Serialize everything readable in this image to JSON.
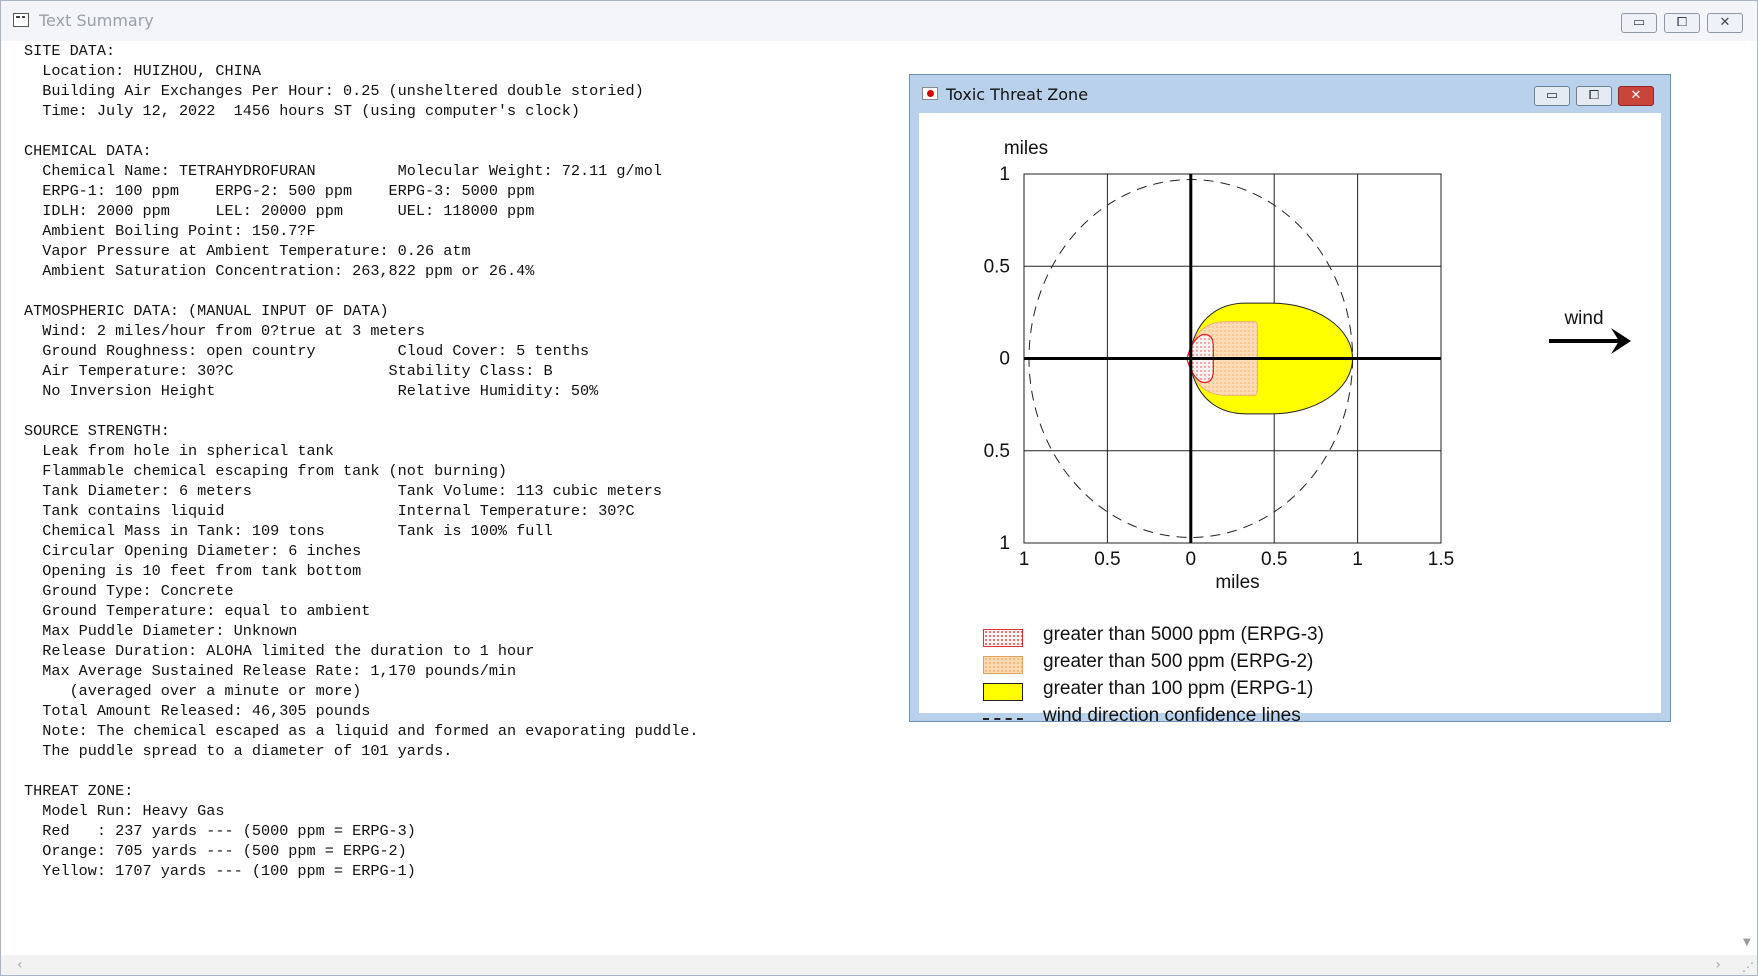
{
  "main_window": {
    "title": "Text Summary",
    "controls": {
      "minimize": "▭",
      "maximize": "⧠",
      "close": "✕"
    },
    "lines": [
      "SITE DATA:",
      "  Location: HUIZHOU, CHINA",
      "  Building Air Exchanges Per Hour: 0.25 (unsheltered double storied)",
      "  Time: July 12, 2022  1456 hours ST (using computer's clock)",
      "",
      "CHEMICAL DATA:",
      "  Chemical Name: TETRAHYDROFURAN         Molecular Weight: 72.11 g/mol",
      "  ERPG-1: 100 ppm    ERPG-2: 500 ppm    ERPG-3: 5000 ppm",
      "  IDLH: 2000 ppm     LEL: 20000 ppm      UEL: 118000 ppm",
      "  Ambient Boiling Point: 150.7?F",
      "  Vapor Pressure at Ambient Temperature: 0.26 atm",
      "  Ambient Saturation Concentration: 263,822 ppm or 26.4%",
      "",
      "ATMOSPHERIC DATA: (MANUAL INPUT OF DATA)",
      "  Wind: 2 miles/hour from 0?true at 3 meters",
      "  Ground Roughness: open country         Cloud Cover: 5 tenths",
      "  Air Temperature: 30?C                 Stability Class: B",
      "  No Inversion Height                    Relative Humidity: 50%",
      "",
      "SOURCE STRENGTH:",
      "  Leak from hole in spherical tank",
      "  Flammable chemical escaping from tank (not burning)",
      "  Tank Diameter: 6 meters                Tank Volume: 113 cubic meters",
      "  Tank contains liquid                   Internal Temperature: 30?C",
      "  Chemical Mass in Tank: 109 tons        Tank is 100% full",
      "  Circular Opening Diameter: 6 inches",
      "  Opening is 10 feet from tank bottom",
      "  Ground Type: Concrete",
      "  Ground Temperature: equal to ambient",
      "  Max Puddle Diameter: Unknown",
      "  Release Duration: ALOHA limited the duration to 1 hour",
      "  Max Average Sustained Release Rate: 1,170 pounds/min",
      "     (averaged over a minute or more)",
      "  Total Amount Released: 46,305 pounds",
      "  Note: The chemical escaped as a liquid and formed an evaporating puddle.",
      "  The puddle spread to a diameter of 101 yards.",
      "",
      "THREAT ZONE:",
      "  Model Run: Heavy Gas",
      "  Red   : 237 yards --- (5000 ppm = ERPG-3)",
      "  Orange: 705 yards --- (500 ppm = ERPG-2)",
      "  Yellow: 1707 yards --- (100 ppm = ERPG-1)"
    ]
  },
  "threat_window": {
    "title": "Toxic Threat Zone",
    "controls": {
      "minimize": "▭",
      "maximize": "⧠",
      "close": "✕"
    },
    "wind_label": "wind"
  },
  "chart_data": {
    "type": "area",
    "xlabel": "miles",
    "ylabel": "miles",
    "xlim": [
      -1,
      1.5
    ],
    "ylim": [
      -1,
      1
    ],
    "x_ticks": [
      -1,
      -0.5,
      0,
      0.5,
      1,
      1.5
    ],
    "x_tick_labels": [
      "1",
      "0.5",
      "0",
      "0.5",
      "1",
      "1.5"
    ],
    "y_ticks": [
      1,
      0.5,
      0,
      -0.5,
      -1
    ],
    "y_tick_labels": [
      "1",
      "0.5",
      "0",
      "0.5",
      "1"
    ],
    "grid": true,
    "zones": [
      {
        "name": "Yellow",
        "threshold_ppm": 100,
        "downwind_miles": 0.97,
        "max_half_width_miles": 0.3,
        "color": "#ffff00"
      },
      {
        "name": "Orange",
        "threshold_ppm": 500,
        "downwind_miles": 0.4,
        "max_half_width_miles": 0.2,
        "color": "#ffd6a8"
      },
      {
        "name": "Red",
        "threshold_ppm": 5000,
        "downwind_miles": 0.135,
        "max_half_width_miles": 0.13,
        "color": "#ffecec"
      }
    ],
    "confidence_circle_radius_miles": 0.97,
    "legend": [
      {
        "label": "greater than 5000 ppm (ERPG-3)",
        "swatch": "red"
      },
      {
        "label": "greater than 500 ppm (ERPG-2)",
        "swatch": "orange"
      },
      {
        "label": "greater than 100 ppm (ERPG-1)",
        "swatch": "yellow"
      },
      {
        "label": "wind direction confidence lines",
        "swatch": "dash"
      }
    ]
  }
}
